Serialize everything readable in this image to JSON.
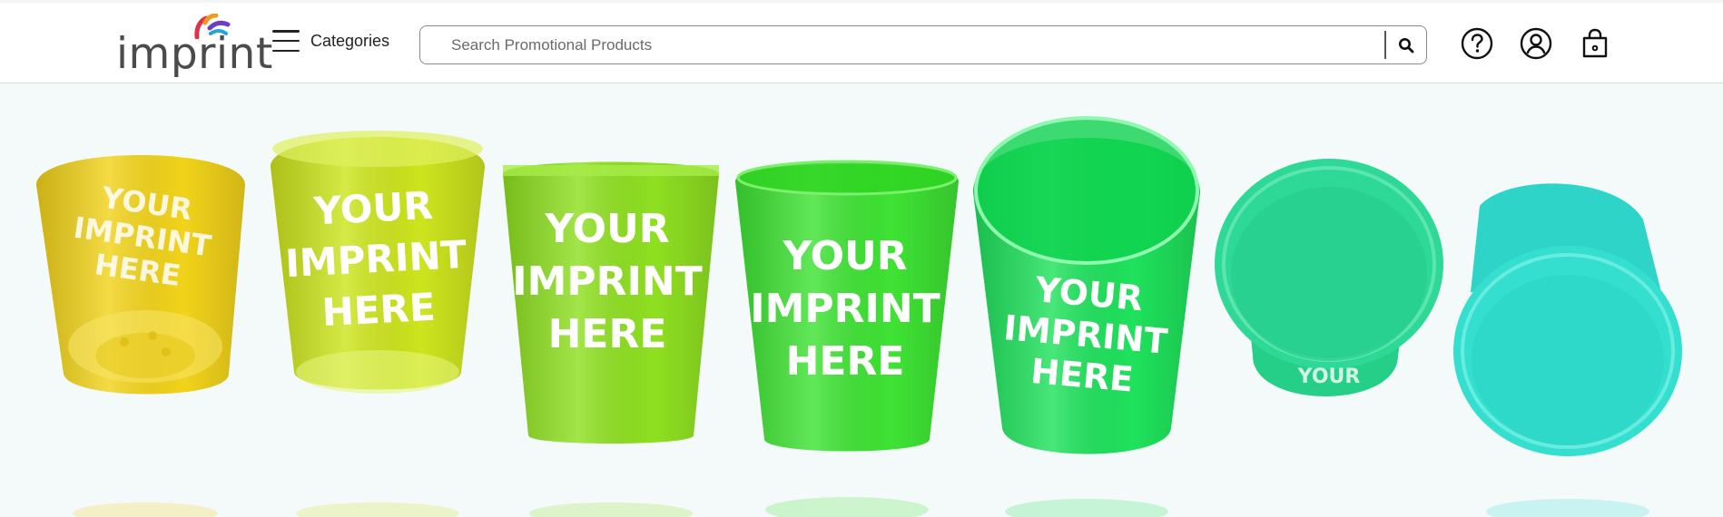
{
  "brand": {
    "name": "imprint"
  },
  "nav": {
    "categories_label": "Categories"
  },
  "search": {
    "placeholder": "Search Promotional Products"
  },
  "header_icons": [
    "help-icon",
    "account-icon",
    "cart-icon"
  ],
  "hero": {
    "cups": [
      {
        "color": "#f2d31b",
        "text": [
          "YOUR",
          "IMPRINT",
          "HERE"
        ]
      },
      {
        "color": "#cde51e",
        "text": [
          "YOUR",
          "IMPRINT",
          "HERE"
        ]
      },
      {
        "color": "#8fe021",
        "text": [
          "YOUR",
          "IMPRINT",
          "HERE"
        ]
      },
      {
        "color": "#3fe334",
        "text": [
          "YOUR",
          "IMPRINT",
          "HERE"
        ]
      },
      {
        "color": "#1fe25c",
        "text": [
          "YOUR",
          "IMPRINT",
          "HERE"
        ]
      },
      {
        "color": "#2ed896",
        "text": []
      },
      {
        "color": "#34dfd0",
        "text": []
      }
    ]
  },
  "colors": {
    "text": "#222222",
    "border": "#8a8a8a",
    "hero_bg": "#f4f9f9"
  }
}
